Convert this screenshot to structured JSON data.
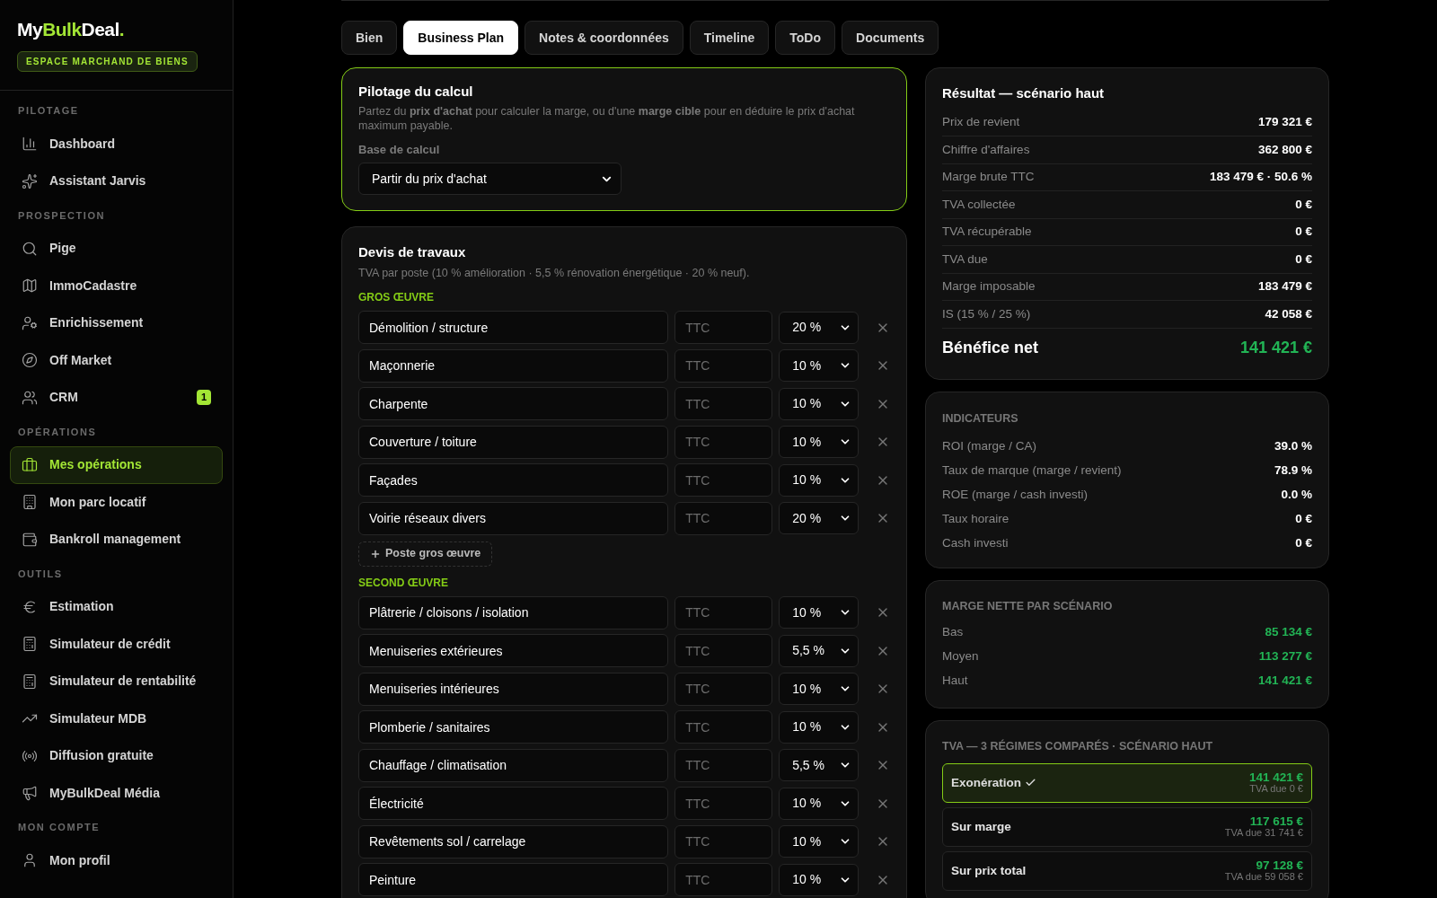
{
  "sidebar": {
    "logo": [
      {
        "text": "My",
        "accent": false
      },
      {
        "text": "Bulk",
        "accent": true
      },
      {
        "text": "Deal",
        "accent": false
      },
      {
        "text": ".",
        "accent": true
      }
    ],
    "badge": "ESPACE MARCHAND DE BIENS",
    "sections": [
      {
        "title": "PILOTAGE",
        "items": [
          {
            "label": "Dashboard",
            "selected": false
          },
          {
            "label": "Assistant Jarvis",
            "selected": false
          }
        ]
      },
      {
        "title": "PROSPECTION",
        "items": [
          {
            "label": "Pige",
            "selected": false
          },
          {
            "label": "ImmoCadastre",
            "selected": false
          },
          {
            "label": "Enrichissement",
            "selected": false
          },
          {
            "label": "Off Market",
            "selected": false
          },
          {
            "label": "CRM",
            "selected": false,
            "count": "1"
          }
        ]
      },
      {
        "title": "OPÉRATIONS",
        "items": [
          {
            "label": "Mes opérations",
            "selected": true
          },
          {
            "label": "Mon parc locatif",
            "selected": false
          },
          {
            "label": "Bankroll management",
            "selected": false
          }
        ]
      },
      {
        "title": "OUTILS",
        "items": [
          {
            "label": "Estimation",
            "selected": false
          },
          {
            "label": "Simulateur de crédit",
            "selected": false
          },
          {
            "label": "Simulateur de rentabilité",
            "selected": false
          },
          {
            "label": "Simulateur MDB",
            "selected": false
          },
          {
            "label": "Diffusion gratuite",
            "selected": false
          },
          {
            "label": "MyBulkDeal Média",
            "selected": false
          }
        ]
      },
      {
        "title": "MON COMPTE",
        "items": [
          {
            "label": "Mon profil",
            "selected": false
          }
        ]
      }
    ]
  },
  "tabs": [
    {
      "label": "Bien",
      "selected": false
    },
    {
      "label": "Business Plan",
      "selected": true
    },
    {
      "label": "Notes & coordonnées",
      "selected": false
    },
    {
      "label": "Timeline",
      "selected": false
    },
    {
      "label": "ToDo",
      "selected": false
    },
    {
      "label": "Documents",
      "selected": false
    }
  ],
  "pilotage": {
    "title": "Pilotage du calcul",
    "description": "Partez du **prix d'achat** pour calculer la marge, ou d'une **marge cible** pour en déduire le prix d'achat maximum payable.",
    "field_label": "Base de calcul",
    "field_value": "Partir du prix d'achat"
  },
  "devis": {
    "title": "Devis de travaux",
    "note": "TVA par poste (10 % amélioration · 5,5 % rénovation énergétique · 20 % neuf).",
    "groups": [
      {
        "title": "GROS ŒUVRE",
        "add_button": "Poste gros œuvre",
        "rows": [
          {
            "label": "Démolition / structure",
            "placeholder": "TTC",
            "vat": "20 %"
          },
          {
            "label": "Maçonnerie",
            "placeholder": "TTC",
            "vat": "10 %"
          },
          {
            "label": "Charpente",
            "placeholder": "TTC",
            "vat": "10 %"
          },
          {
            "label": "Couverture / toiture",
            "placeholder": "TTC",
            "vat": "10 %"
          },
          {
            "label": "Façades",
            "placeholder": "TTC",
            "vat": "10 %"
          },
          {
            "label": "Voirie réseaux divers",
            "placeholder": "TTC",
            "vat": "20 %"
          }
        ]
      },
      {
        "title": "SECOND ŒUVRE",
        "rows": [
          {
            "label": "Plâtrerie / cloisons / isolation",
            "placeholder": "TTC",
            "vat": "10 %"
          },
          {
            "label": "Menuiseries extérieures",
            "placeholder": "TTC",
            "vat": "5,5 %"
          },
          {
            "label": "Menuiseries intérieures",
            "placeholder": "TTC",
            "vat": "10 %"
          },
          {
            "label": "Plomberie / sanitaires",
            "placeholder": "TTC",
            "vat": "10 %"
          },
          {
            "label": "Chauffage / climatisation",
            "placeholder": "TTC",
            "vat": "5,5 %"
          },
          {
            "label": "Électricité",
            "placeholder": "TTC",
            "vat": "10 %"
          },
          {
            "label": "Revêtements sol / carrelage",
            "placeholder": "TTC",
            "vat": "10 %"
          },
          {
            "label": "Peinture",
            "placeholder": "TTC",
            "vat": "10 %"
          }
        ]
      }
    ]
  },
  "result": {
    "title": "Résultat — scénario haut",
    "rows": [
      {
        "label": "Prix de revient",
        "value": "179 321 €"
      },
      {
        "label": "Chiffre d'affaires",
        "value": "362 800 €"
      },
      {
        "label": "Marge brute TTC",
        "value": "183 479 € · 50.6 %"
      },
      {
        "label": "TVA collectée",
        "value": "0 €"
      },
      {
        "label": "TVA récupérable",
        "value": "0 €"
      },
      {
        "label": "TVA due",
        "value": "0 €"
      },
      {
        "label": "Marge imposable",
        "value": "183 479 €"
      },
      {
        "label": "IS (15 % / 25 %)",
        "value": "42 058 €"
      }
    ],
    "total": {
      "label": "Bénéfice net",
      "value": "141 421 €"
    }
  },
  "indicators": {
    "title": "INDICATEURS",
    "rows": [
      {
        "label": "ROI (marge / CA)",
        "value": "39.0 %"
      },
      {
        "label": "Taux de marque (marge / revient)",
        "value": "78.9 %"
      },
      {
        "label": "ROE (marge / cash investi)",
        "value": "0.0 %"
      },
      {
        "label": "Taux horaire",
        "value": "0 €"
      },
      {
        "label": "Cash investi",
        "value": "0 €"
      }
    ]
  },
  "scenarios": {
    "title": "MARGE NETTE PAR SCÉNARIO",
    "rows": [
      {
        "label": "Bas",
        "value": "85 134 €"
      },
      {
        "label": "Moyen",
        "value": "113 277 €"
      },
      {
        "label": "Haut",
        "value": "141 421 €"
      }
    ]
  },
  "tva": {
    "title": "TVA — 3 RÉGIMES COMPARÉS · SCÉNARIO HAUT",
    "options": [
      {
        "label": "Exonération",
        "selected": true,
        "value": "141 421 €",
        "due": "TVA due 0 €"
      },
      {
        "label": "Sur marge",
        "selected": false,
        "value": "117 615 €",
        "due": "TVA due 31 741 €"
      },
      {
        "label": "Sur prix total",
        "selected": false,
        "value": "97 128 €",
        "due": "TVA due 59 058 €"
      }
    ]
  }
}
